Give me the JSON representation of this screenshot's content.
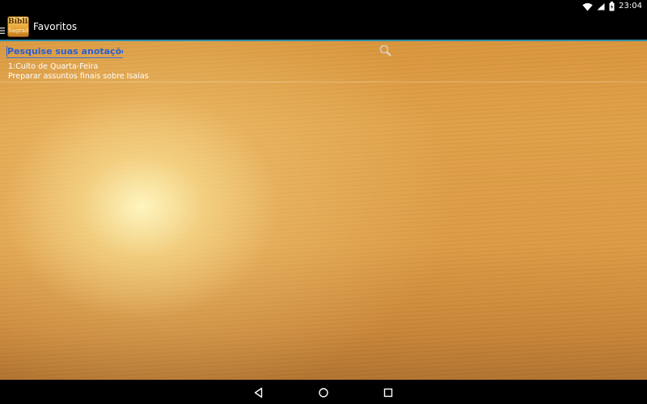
{
  "status_bar": {
    "time": "23:04",
    "icons": [
      "wifi-icon",
      "signal-icon",
      "battery-icon"
    ]
  },
  "action_bar": {
    "app_logo": {
      "line1": "Bíblia",
      "line2": "Sagrada"
    },
    "title": "Favoritos",
    "icons": [
      "menu-icon"
    ]
  },
  "search": {
    "placeholder": "Pesquise suas anotações!",
    "value": "",
    "button_icon": "search-icon"
  },
  "notes": [
    {
      "title": "1:Culto de Quarta-Feira",
      "body": "Preparar assuntos finais sobre Isaias"
    }
  ],
  "nav_bar": {
    "icons": [
      "back-icon",
      "home-icon",
      "recents-icon"
    ]
  },
  "colors": {
    "accent": "#2a5fd0",
    "action_bar_divider": "#2f8fa8",
    "background_wood": "#dc9a45"
  }
}
